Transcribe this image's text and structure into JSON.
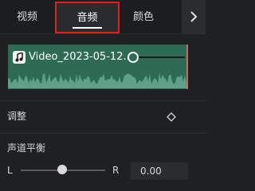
{
  "tabs": {
    "video": "视频",
    "audio": "音频",
    "color": "颜色"
  },
  "clip": {
    "name": "Video_2023-05-12...",
    "color": "#2d6b55",
    "volume_fraction": 0.1
  },
  "adjust": {
    "label": "调整"
  },
  "balance": {
    "label": "声道平衡",
    "left_label": "L",
    "right_label": "R",
    "value": "0.00",
    "position_fraction": 0.5
  },
  "icons": {
    "more": "chevron-right-icon",
    "music": "music-note-icon",
    "keyframe": "diamond-icon"
  }
}
